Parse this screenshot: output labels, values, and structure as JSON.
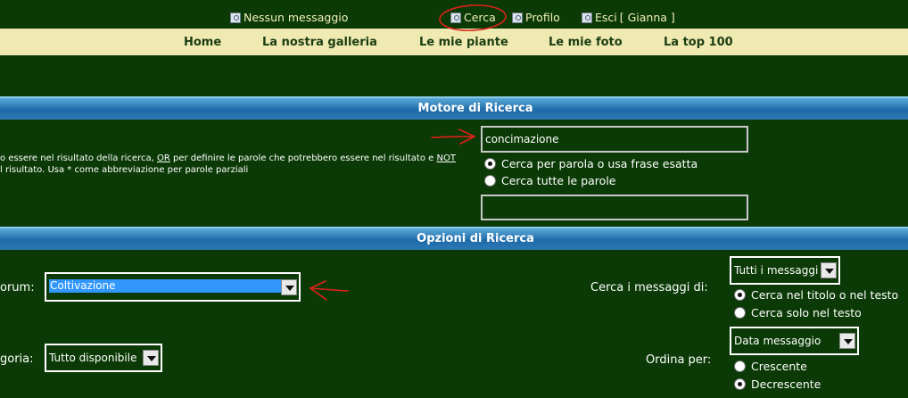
{
  "topbar": {
    "messages": "Nessun messaggio",
    "search": "Cerca",
    "profile": "Profilo",
    "logout": "Esci",
    "user": "[ Gianna ]"
  },
  "nav": {
    "items": [
      "Home",
      "La nostra galleria",
      "Le mie piante",
      "Le mie foto",
      "La top 100"
    ]
  },
  "search_engine": {
    "title": "Motore di Ricerca",
    "help_line1_a": "o essere nel risultato della ricerca,",
    "help_or": "OR",
    "help_line1_b": "per definire le parole che potrebbero essere nel risultato e",
    "help_not": "NOT",
    "help_line2": "l risultato. Usa * come abbreviazione per parole parziali",
    "keyword_value": "concimazione",
    "radio_exact": "Cerca per parola o usa frase esatta",
    "radio_all": "Cerca tutte le parole",
    "author_value": ""
  },
  "options": {
    "title": "Opzioni di Ricerca",
    "forum_label": "orum:",
    "forum_value": "Coltivazione",
    "category_label": "goria:",
    "category_value": "Tutto disponibile",
    "search_in_label": "Cerca i messaggi di:",
    "search_in_value": "Tutti i messaggi",
    "radio_title_text": "Cerca nel titolo o nel testo",
    "radio_text_only": "Cerca solo nel testo",
    "sort_label": "Ordina per:",
    "sort_value": "Data messaggio",
    "radio_asc": "Crescente",
    "radio_desc": "Decrescente"
  },
  "colors": {
    "background": "#0b3a06",
    "nav_bar": "#efe9b2",
    "section_header": "#2c78b5",
    "annotation": "#e0201a"
  }
}
